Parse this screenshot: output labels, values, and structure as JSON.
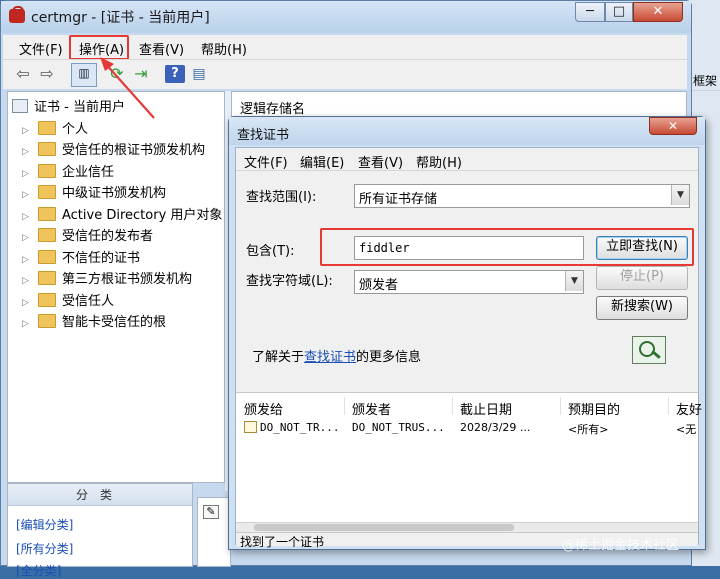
{
  "main_window": {
    "title": "certmgr - [证书 - 当前用户]",
    "controls": {
      "minimize": "─",
      "maximize": "□",
      "close": "✕"
    },
    "menu": {
      "file": "文件(F)",
      "action": "操作(A)",
      "view": "查看(V)",
      "help": "帮助(H)"
    },
    "toolbar": {
      "back": "⇦",
      "forward": "⇨",
      "help": "?",
      "refresh": "⟳",
      "export": "⇥",
      "properties": "▤",
      "tree": "▥"
    },
    "tree": {
      "root": "证书 - 当前用户",
      "items": [
        "个人",
        "受信任的根证书颁发机构",
        "企业信任",
        "中级证书颁发机构",
        "Active Directory 用户对象",
        "受信任的发布者",
        "不信任的证书",
        "第三方根证书颁发机构",
        "受信任人",
        "智能卡受信任的根"
      ]
    },
    "right_header": "逻辑存储名",
    "categories": {
      "header": "分类",
      "edit": "[编辑分类]",
      "all": "[所有分类]",
      "more": "[全分类]"
    }
  },
  "background_window": {
    "label": "框架"
  },
  "find_dialog": {
    "title": "查找证书",
    "close": "✕",
    "menu": {
      "file": "文件(F)",
      "edit": "编辑(E)",
      "view": "查看(V)",
      "help": "帮助(H)"
    },
    "scope_label": "查找范围(I):",
    "scope_value": "所有证书存储",
    "contains_label": "包含(T):",
    "contains_value": "fiddler",
    "field_label": "查找字符域(L):",
    "field_value": "颁发者",
    "find_now": "立即查找(N)",
    "stop": "停止(P)",
    "new_search": "新搜索(W)",
    "learn_prefix": "了解关于",
    "learn_link": "查找证书",
    "learn_suffix": "的更多信息",
    "columns": [
      "颁发给",
      "颁发者",
      "截止日期",
      "预期目的",
      "友好"
    ],
    "rows": [
      {
        "issued_to": "DO_NOT_TR...",
        "issued_by": "DO_NOT_TRUS...",
        "expiration": "2028/3/29 ...",
        "purpose": "<所有>",
        "friendly": "<无"
      }
    ],
    "status": "找到了一个证书"
  },
  "watermark": "@稀土掘金技术社区",
  "colors": {
    "highlight": "#e53935",
    "link": "#1a4fb5",
    "title_bar": "#c6d9ee"
  }
}
